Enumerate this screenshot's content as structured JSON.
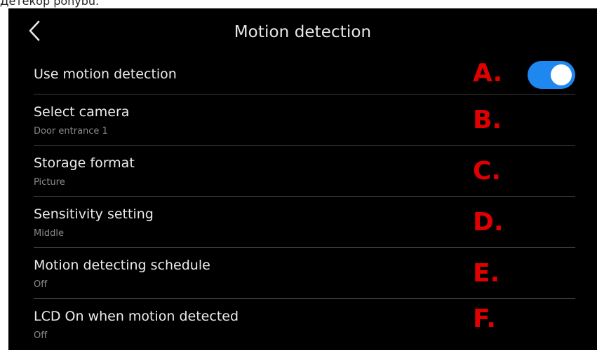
{
  "caption": "Детекор pohybu.",
  "header": {
    "title": "Motion detection"
  },
  "rows": [
    {
      "label": "Use motion detection",
      "value": "",
      "marker": "A."
    },
    {
      "label": "Select camera",
      "value": "Door entrance 1",
      "marker": "B."
    },
    {
      "label": "Storage format",
      "value": "Picture",
      "marker": "C."
    },
    {
      "label": "Sensitivity setting",
      "value": "Middle",
      "marker": "D."
    },
    {
      "label": "Motion detecting schedule",
      "value": "Off",
      "marker": "E."
    },
    {
      "label": "LCD On when motion detected",
      "value": "Off",
      "marker": "F."
    }
  ],
  "toggle": {
    "state": "on",
    "color": "#1e88f0"
  }
}
